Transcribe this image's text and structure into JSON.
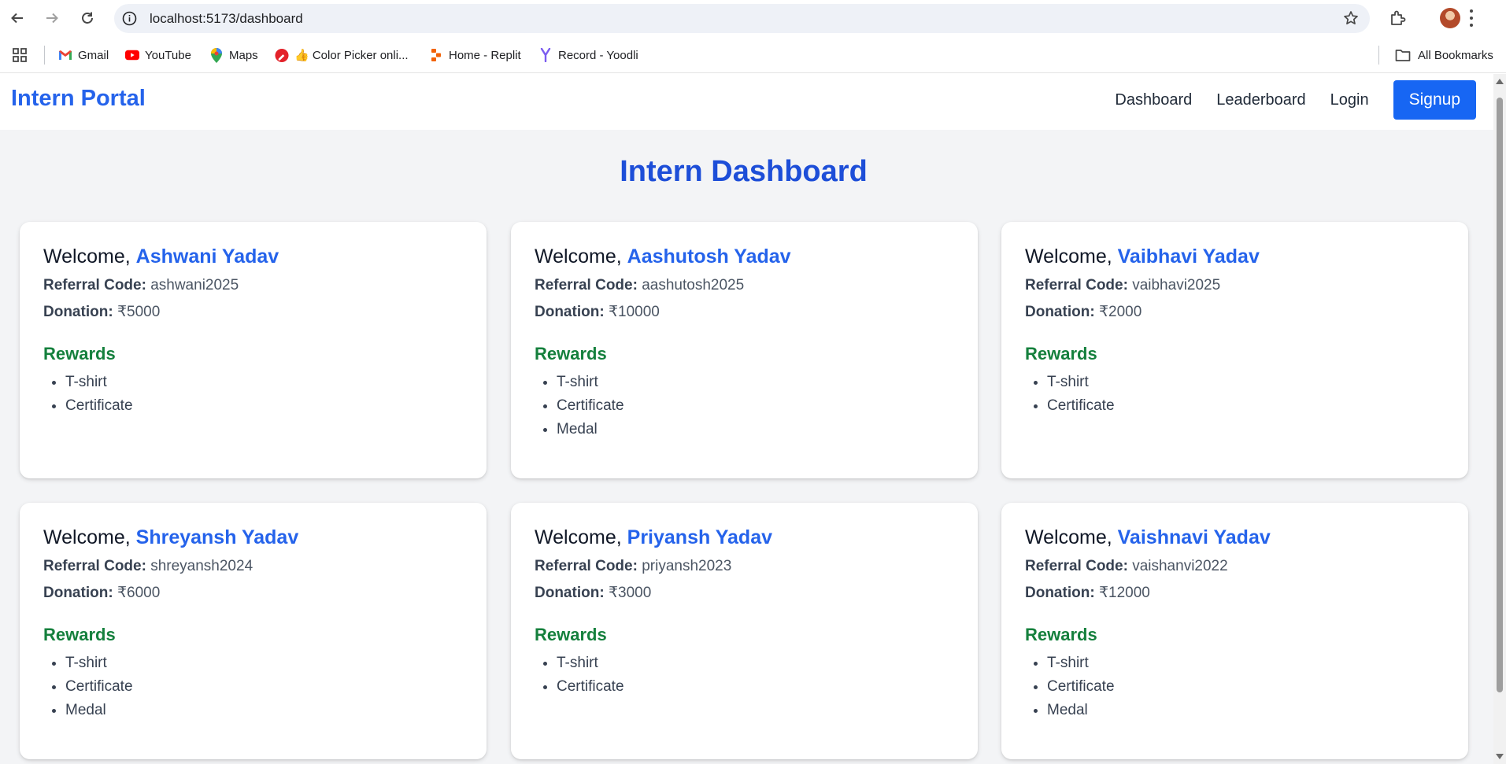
{
  "browser": {
    "url": "localhost:5173/dashboard",
    "bookmarks": [
      {
        "label": "Gmail",
        "icon": "gmail-icon"
      },
      {
        "label": "YouTube",
        "icon": "youtube-icon"
      },
      {
        "label": "Maps",
        "icon": "maps-icon"
      },
      {
        "label": "👍 Color Picker onli...",
        "icon": "color-picker-icon"
      },
      {
        "label": "Home - Replit",
        "icon": "replit-icon"
      },
      {
        "label": "Record - Yoodli",
        "icon": "yoodli-icon"
      }
    ],
    "all_bookmarks": "All Bookmarks"
  },
  "site": {
    "brand": "Intern Portal",
    "nav": {
      "dashboard": "Dashboard",
      "leaderboard": "Leaderboard",
      "login": "Login",
      "signup": "Signup"
    },
    "title": "Intern Dashboard",
    "welcome_prefix": "Welcome, ",
    "referral_label": "Referral Code:",
    "donation_label": "Donation:",
    "rewards_heading": "Rewards"
  },
  "interns": [
    {
      "name": "Ashwani Yadav",
      "referral": "ashwani2025",
      "donation": "₹5000",
      "rewards": [
        "T-shirt",
        "Certificate"
      ]
    },
    {
      "name": "Aashutosh Yadav",
      "referral": "aashutosh2025",
      "donation": "₹10000",
      "rewards": [
        "T-shirt",
        "Certificate",
        "Medal"
      ]
    },
    {
      "name": "Vaibhavi Yadav",
      "referral": "vaibhavi2025",
      "donation": "₹2000",
      "rewards": [
        "T-shirt",
        "Certificate"
      ]
    },
    {
      "name": "Shreyansh Yadav",
      "referral": "shreyansh2024",
      "donation": "₹6000",
      "rewards": [
        "T-shirt",
        "Certificate",
        "Medal"
      ]
    },
    {
      "name": "Priyansh Yadav",
      "referral": "priyansh2023",
      "donation": "₹3000",
      "rewards": [
        "T-shirt",
        "Certificate"
      ]
    },
    {
      "name": "Vaishnavi Yadav",
      "referral": "vaishanvi2022",
      "donation": "₹12000",
      "rewards": [
        "T-shirt",
        "Certificate",
        "Medal"
      ]
    }
  ],
  "colors": {
    "brand_blue": "#2563eb",
    "title_blue": "#1d4ed8",
    "signup_bg": "#1766f3",
    "rewards_green": "#15803d",
    "page_bg": "#f3f4f6"
  }
}
